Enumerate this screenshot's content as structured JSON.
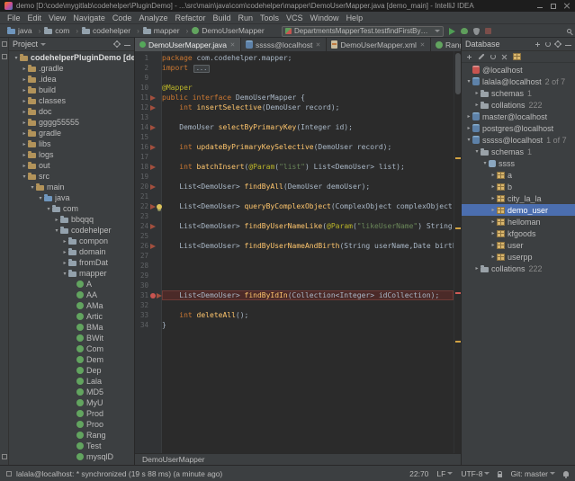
{
  "window": {
    "title": "demo [D:\\code\\mygitlab\\codehelper\\PluginDemo] - ...\\src\\main\\java\\com\\codehelper\\mapper\\DemoUserMapper.java [demo_main] - IntelliJ IDEA"
  },
  "menu": {
    "items": [
      "File",
      "Edit",
      "View",
      "Navigate",
      "Code",
      "Analyze",
      "Refactor",
      "Build",
      "Run",
      "Tools",
      "VCS",
      "Window",
      "Help"
    ]
  },
  "navbar": {
    "crumbs": [
      {
        "label": "java",
        "icon": "folder-src"
      },
      {
        "label": "com",
        "icon": "package"
      },
      {
        "label": "codehelper",
        "icon": "package"
      },
      {
        "label": "mapper",
        "icon": "package"
      },
      {
        "label": "DemoUserMapper",
        "icon": "class"
      }
    ],
    "run_config": {
      "label": "DepartmentsMapperTest.testfindFirstByDepartmentId",
      "icon": "test"
    },
    "actions": [
      "play",
      "bug",
      "shield",
      "stop"
    ]
  },
  "project": {
    "header": "Project",
    "header_icons": [
      "gear",
      "minus"
    ],
    "tree": [
      {
        "indent": 0,
        "exp": true,
        "icon": "folder-project",
        "label": "codehelperPluginDemo [demo",
        "bold": true
      },
      {
        "indent": 1,
        "exp": false,
        "icon": "folder",
        "label": ".gradle"
      },
      {
        "indent": 1,
        "exp": false,
        "icon": "folder",
        "label": ".idea"
      },
      {
        "indent": 1,
        "exp": false,
        "icon": "folder",
        "label": "build"
      },
      {
        "indent": 1,
        "exp": false,
        "icon": "folder",
        "label": "classes"
      },
      {
        "indent": 1,
        "exp": false,
        "icon": "folder",
        "label": "doc"
      },
      {
        "indent": 1,
        "exp": false,
        "icon": "folder",
        "label": "gggg55555"
      },
      {
        "indent": 1,
        "exp": false,
        "icon": "folder",
        "label": "gradle"
      },
      {
        "indent": 1,
        "exp": false,
        "icon": "folder",
        "label": "libs"
      },
      {
        "indent": 1,
        "exp": false,
        "icon": "folder",
        "label": "logs"
      },
      {
        "indent": 1,
        "exp": false,
        "icon": "folder",
        "label": "out"
      },
      {
        "indent": 1,
        "exp": true,
        "icon": "folder",
        "label": "src"
      },
      {
        "indent": 2,
        "exp": true,
        "icon": "folder",
        "label": "main"
      },
      {
        "indent": 3,
        "exp": true,
        "icon": "folder-src",
        "label": "java"
      },
      {
        "indent": 4,
        "exp": true,
        "icon": "package",
        "label": "com"
      },
      {
        "indent": 5,
        "exp": false,
        "icon": "package",
        "label": "bbqqq"
      },
      {
        "indent": 5,
        "exp": true,
        "icon": "package",
        "label": "codehelper"
      },
      {
        "indent": 6,
        "exp": false,
        "icon": "package",
        "label": "compon"
      },
      {
        "indent": 6,
        "exp": false,
        "icon": "package",
        "label": "domain"
      },
      {
        "indent": 6,
        "exp": false,
        "icon": "package",
        "label": "fromDat"
      },
      {
        "indent": 6,
        "exp": true,
        "icon": "package",
        "label": "mapper"
      },
      {
        "indent": 7,
        "exp": null,
        "icon": "class",
        "label": "A"
      },
      {
        "indent": 7,
        "exp": null,
        "icon": "class",
        "label": "AA"
      },
      {
        "indent": 7,
        "exp": null,
        "icon": "class",
        "label": "AMa"
      },
      {
        "indent": 7,
        "exp": null,
        "icon": "class",
        "label": "Artic"
      },
      {
        "indent": 7,
        "exp": null,
        "icon": "class",
        "label": "BMa"
      },
      {
        "indent": 7,
        "exp": null,
        "icon": "class",
        "label": "BWit"
      },
      {
        "indent": 7,
        "exp": null,
        "icon": "class",
        "label": "Com"
      },
      {
        "indent": 7,
        "exp": null,
        "icon": "class",
        "label": "Dem"
      },
      {
        "indent": 7,
        "exp": null,
        "icon": "class",
        "label": "Dep"
      },
      {
        "indent": 7,
        "exp": null,
        "icon": "class",
        "label": "Lala"
      },
      {
        "indent": 7,
        "exp": null,
        "icon": "class",
        "label": "MD5"
      },
      {
        "indent": 7,
        "exp": null,
        "icon": "class",
        "label": "MyU"
      },
      {
        "indent": 7,
        "exp": null,
        "icon": "class",
        "label": "Prod"
      },
      {
        "indent": 7,
        "exp": null,
        "icon": "class",
        "label": "Proo"
      },
      {
        "indent": 7,
        "exp": null,
        "icon": "class",
        "label": "Rang"
      },
      {
        "indent": 7,
        "exp": null,
        "icon": "class",
        "label": "Test"
      },
      {
        "indent": 7,
        "exp": null,
        "icon": "class",
        "label": "mysqlD"
      }
    ]
  },
  "tabs": [
    {
      "label": "DemoUserMapper.java",
      "icon": "dot-green",
      "active": true
    },
    {
      "label": "sssss@localhost",
      "icon": "db-blue",
      "active": false
    },
    {
      "label": "DemoUserMapper.xml",
      "icon": "xml",
      "active": false
    },
    {
      "label": "Range.java",
      "icon": "class",
      "active": false
    }
  ],
  "editor": {
    "breadcrumb": "DemoUserMapper",
    "lines": [
      {
        "n": "1",
        "segs": [
          [
            "k",
            "package "
          ],
          [
            "p",
            "com.codehelper.mapper;"
          ]
        ]
      },
      {
        "n": "2",
        "segs": [
          [
            "k",
            "import "
          ],
          [
            "f",
            "..."
          ]
        ]
      },
      {
        "n": "9",
        "segs": []
      },
      {
        "n": "10",
        "segs": [
          [
            "a",
            "@Mapper"
          ]
        ]
      },
      {
        "n": "11",
        "segs": [
          [
            "k",
            "public interface "
          ],
          [
            "p",
            "DemoUserMapper {"
          ]
        ],
        "icons": [
          "mapper"
        ]
      },
      {
        "n": "12",
        "segs": [
          [
            "p",
            "    "
          ],
          [
            "k",
            "int"
          ],
          [
            "p",
            " "
          ],
          [
            "m",
            "insertSelective"
          ],
          [
            "p",
            "(DemoUser record);"
          ]
        ],
        "icons": [
          "mapper"
        ]
      },
      {
        "n": "13",
        "segs": []
      },
      {
        "n": "14",
        "segs": [
          [
            "p",
            "    DemoUser "
          ],
          [
            "m",
            "selectByPrimaryKey"
          ],
          [
            "p",
            "(Integer id);"
          ]
        ],
        "icons": [
          "mapper"
        ]
      },
      {
        "n": "15",
        "segs": []
      },
      {
        "n": "16",
        "segs": [
          [
            "p",
            "    "
          ],
          [
            "k",
            "int"
          ],
          [
            "p",
            " "
          ],
          [
            "m",
            "updateByPrimaryKeySelective"
          ],
          [
            "p",
            "(DemoUser record);"
          ]
        ],
        "icons": [
          "mapper"
        ]
      },
      {
        "n": "17",
        "segs": []
      },
      {
        "n": "18",
        "segs": [
          [
            "p",
            "    "
          ],
          [
            "k",
            "int"
          ],
          [
            "p",
            " "
          ],
          [
            "m",
            "batchInsert"
          ],
          [
            "p",
            "("
          ],
          [
            "a",
            "@Param"
          ],
          [
            "p",
            "("
          ],
          [
            "s",
            "\"list\""
          ],
          [
            "p",
            ") List<DemoUser> list);"
          ]
        ],
        "icons": [
          "mapper"
        ]
      },
      {
        "n": "19",
        "segs": []
      },
      {
        "n": "20",
        "segs": [
          [
            "p",
            "    List<DemoUser> "
          ],
          [
            "m",
            "findByAll"
          ],
          [
            "p",
            "(DemoUser demoUser);"
          ]
        ],
        "icons": [
          "mapper"
        ]
      },
      {
        "n": "21",
        "segs": []
      },
      {
        "n": "22",
        "segs": [
          [
            "p",
            "    List<DemoUser> "
          ],
          [
            "m",
            "queryByComplexObject"
          ],
          [
            "p",
            "(ComplexObject complexObject);"
          ]
        ],
        "icons": [
          "mapper",
          "bulb"
        ]
      },
      {
        "n": "23",
        "segs": []
      },
      {
        "n": "24",
        "segs": [
          [
            "p",
            "    List<DemoUser> "
          ],
          [
            "m",
            "findByUserNameLike"
          ],
          [
            "p",
            "("
          ],
          [
            "a",
            "@Param"
          ],
          [
            "p",
            "("
          ],
          [
            "s",
            "\"likeUserName\""
          ],
          [
            "p",
            ") String likeUserName);"
          ]
        ],
        "icons": [
          "mapper"
        ]
      },
      {
        "n": "25",
        "segs": []
      },
      {
        "n": "26",
        "segs": [
          [
            "p",
            "    List<DemoUser> "
          ],
          [
            "m",
            "findByUserNameAndBirth"
          ],
          [
            "p",
            "(String userName,Date birth);"
          ]
        ],
        "icons": [
          "mapper"
        ]
      },
      {
        "n": "27",
        "segs": []
      },
      {
        "n": "28",
        "segs": []
      },
      {
        "n": "29",
        "segs": []
      },
      {
        "n": "30",
        "segs": []
      },
      {
        "n": "31",
        "segs": [
          [
            "p",
            "    List<DemoUser> "
          ],
          [
            "m",
            "findByIdIn"
          ],
          [
            "p",
            "(Collection<Integer> idCollection);"
          ]
        ],
        "icons": [
          "dot-red",
          "mapper"
        ],
        "hl": true
      },
      {
        "n": "32",
        "segs": []
      },
      {
        "n": "33",
        "segs": [
          [
            "p",
            "    "
          ],
          [
            "k",
            "int"
          ],
          [
            "p",
            " "
          ],
          [
            "m",
            "deleteAll"
          ],
          [
            "p",
            "();"
          ]
        ]
      },
      {
        "n": "34",
        "segs": [
          [
            "p",
            "}"
          ]
        ]
      }
    ]
  },
  "database": {
    "header": "Database",
    "header_icons": [
      "plus",
      "sync",
      "gear",
      "minus"
    ],
    "toolbar_icons": [
      "plus",
      "edit",
      "sync",
      "close",
      "table"
    ],
    "tree": [
      {
        "indent": 0,
        "exp": null,
        "icon": "db-red",
        "label": "@localhost"
      },
      {
        "indent": 0,
        "exp": true,
        "icon": "db-blue",
        "label": "lalala@localhost",
        "count": "2 of 7"
      },
      {
        "indent": 1,
        "exp": false,
        "icon": "folder-gray",
        "label": "schemas",
        "count": "1"
      },
      {
        "indent": 1,
        "exp": false,
        "icon": "folder-gray",
        "label": "collations",
        "count": "222"
      },
      {
        "indent": 0,
        "exp": false,
        "icon": "db-blue",
        "label": "master@localhost"
      },
      {
        "indent": 0,
        "exp": false,
        "icon": "db-blue",
        "label": "postgres@localhost"
      },
      {
        "indent": 0,
        "exp": true,
        "icon": "db-blue",
        "label": "sssss@localhost",
        "count": "1 of 7"
      },
      {
        "indent": 1,
        "exp": true,
        "icon": "folder-gray",
        "label": "schemas",
        "count": "1"
      },
      {
        "indent": 2,
        "exp": true,
        "icon": "schema",
        "label": "ssss"
      },
      {
        "indent": 3,
        "exp": false,
        "icon": "table",
        "label": "a"
      },
      {
        "indent": 3,
        "exp": false,
        "icon": "table",
        "label": "b"
      },
      {
        "indent": 3,
        "exp": false,
        "icon": "table",
        "label": "city_la_la"
      },
      {
        "indent": 3,
        "exp": false,
        "icon": "table",
        "label": "demo_user",
        "selected": true
      },
      {
        "indent": 3,
        "exp": false,
        "icon": "table",
        "label": "helloman"
      },
      {
        "indent": 3,
        "exp": false,
        "icon": "table",
        "label": "kfgoods"
      },
      {
        "indent": 3,
        "exp": false,
        "icon": "table",
        "label": "user"
      },
      {
        "indent": 3,
        "exp": false,
        "icon": "table",
        "label": "userpp"
      },
      {
        "indent": 1,
        "exp": false,
        "icon": "folder-gray",
        "label": "collations",
        "count": "222"
      }
    ]
  },
  "status": {
    "left": "lalala@localhost: * synchronized (19 s 88 ms) (a minute ago)",
    "position": "22:70",
    "line_sep": "LF",
    "encoding": "UTF-8",
    "vcs": "Git: master"
  }
}
